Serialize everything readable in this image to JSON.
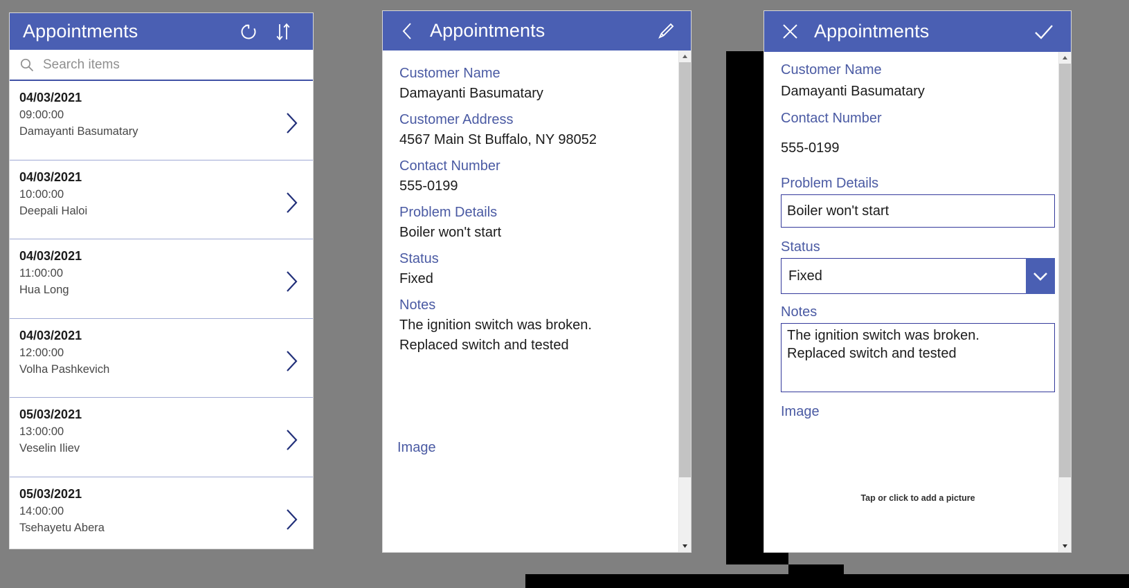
{
  "browse": {
    "title": "Appointments",
    "icons": {
      "refresh": "refresh-icon",
      "sort": "sort-icon"
    },
    "search": {
      "placeholder": "Search items",
      "value": "",
      "icon": "search-icon"
    },
    "items": [
      {
        "date": "04/03/2021",
        "time": "09:00:00",
        "name": "Damayanti Basumatary"
      },
      {
        "date": "04/03/2021",
        "time": "10:00:00",
        "name": "Deepali Haloi"
      },
      {
        "date": "04/03/2021",
        "time": "11:00:00",
        "name": "Hua Long"
      },
      {
        "date": "04/03/2021",
        "time": "12:00:00",
        "name": "Volha Pashkevich"
      },
      {
        "date": "05/03/2021",
        "time": "13:00:00",
        "name": "Veselin Iliev"
      },
      {
        "date": "05/03/2021",
        "time": "14:00:00",
        "name": "Tsehayetu Abera"
      }
    ]
  },
  "detail": {
    "title": "Appointments",
    "icons": {
      "back": "back-chevron-icon",
      "edit": "pencil-icon"
    },
    "fields": [
      {
        "label": "Customer Name",
        "value": "Damayanti Basumatary"
      },
      {
        "label": "Customer Address",
        "value": "4567 Main St Buffalo, NY 98052"
      },
      {
        "label": "Contact Number",
        "value": "555-0199"
      },
      {
        "label": "Problem Details",
        "value": "Boiler won't start"
      },
      {
        "label": "Status",
        "value": "Fixed"
      },
      {
        "label": "Notes",
        "value": "The ignition switch was broken.\nReplaced switch and tested"
      }
    ],
    "image_label": "Image"
  },
  "edit": {
    "title": "Appointments",
    "icons": {
      "cancel": "close-x-icon",
      "accept": "checkmark-icon",
      "dropdown": "chevron-down-icon"
    },
    "customer_name": {
      "label": "Customer Name",
      "value": "Damayanti Basumatary"
    },
    "contact_number": {
      "label": "Contact Number",
      "value": "555-0199"
    },
    "problem_details": {
      "label": "Problem Details",
      "value": "Boiler won't start"
    },
    "status": {
      "label": "Status",
      "value": "Fixed"
    },
    "notes": {
      "label": "Notes",
      "value": "The ignition switch was broken.\nReplaced switch and tested"
    },
    "image": {
      "label": "Image",
      "hint": "Tap or click to add a picture"
    }
  },
  "colors": {
    "header_blue": "#4a5fb3",
    "label_blue": "#4a5aa3",
    "field_border": "#33399b",
    "backdrop_gray": "#808080",
    "divider": "#9fa8d4"
  }
}
